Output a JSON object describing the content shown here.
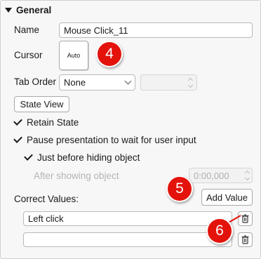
{
  "section": {
    "title": "General",
    "icon": "collapse-triangle-icon"
  },
  "name_field": {
    "label": "Name",
    "value": "Mouse Click_11"
  },
  "cursor": {
    "label": "Cursor",
    "value": "Auto"
  },
  "tab_order": {
    "label": "Tab Order",
    "selected": "None",
    "number_value": ""
  },
  "state_view_button": "State View",
  "retain_state": {
    "label": "Retain State",
    "checked": true
  },
  "pause_presentation": {
    "label": "Pause presentation to wait for user input",
    "checked": true
  },
  "just_before_hiding": {
    "label": "Just before hiding object",
    "checked": true
  },
  "after_showing": {
    "label": "After showing object",
    "value": "0:00,000"
  },
  "correct_values": {
    "label": "Correct Values:",
    "add_button": "Add Value",
    "items": [
      {
        "value": "Left click"
      },
      {
        "value": ""
      }
    ]
  },
  "badges": {
    "b4": "4",
    "b5": "5",
    "b6": "6",
    "color": "#e3130b"
  }
}
